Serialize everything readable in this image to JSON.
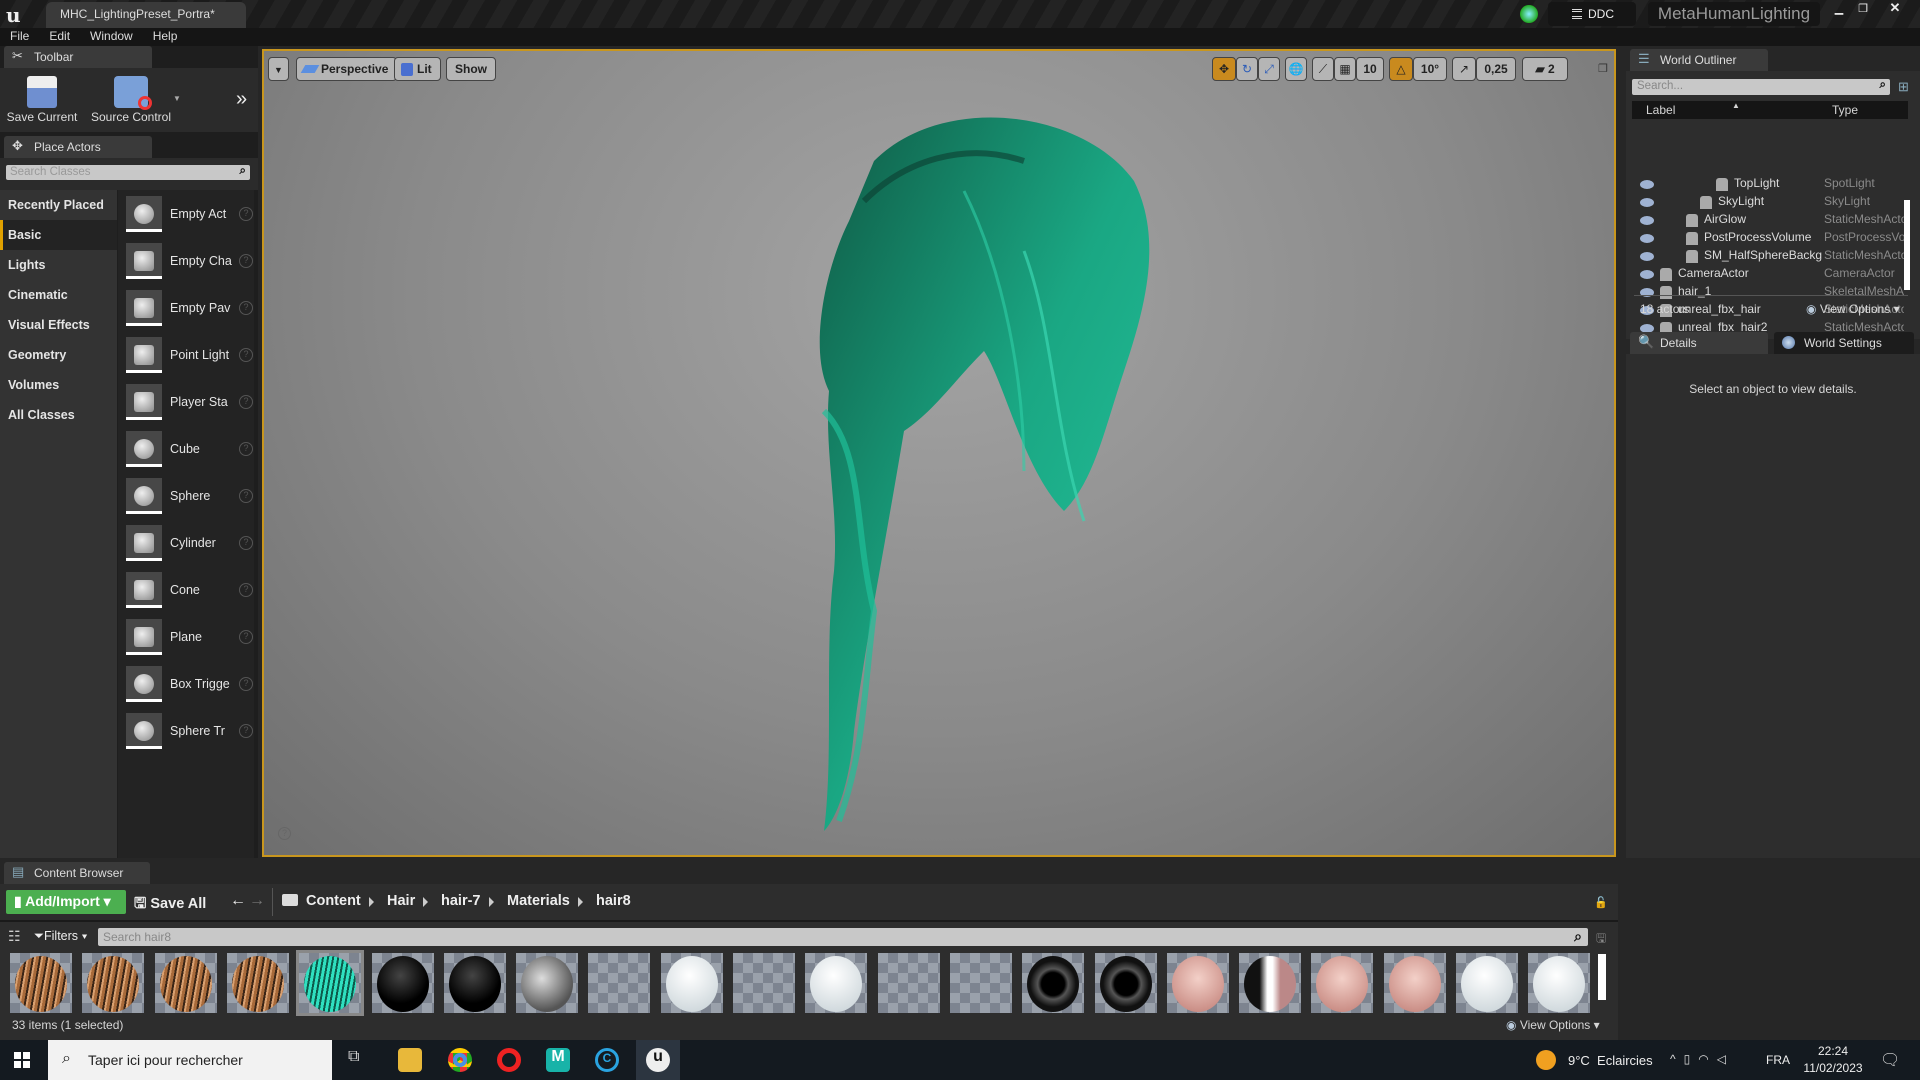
{
  "window": {
    "tab_title": "MHC_LightingPreset_Portra*",
    "ddc_label": "DDC",
    "project_name": "MetaHumanLighting"
  },
  "menu": [
    "File",
    "Edit",
    "Window",
    "Help"
  ],
  "toolbar": {
    "tab": "Toolbar",
    "save_current": "Save Current",
    "source_control": "Source Control"
  },
  "place_actors": {
    "tab": "Place Actors",
    "search_placeholder": "Search Classes",
    "categories": [
      "Recently Placed",
      "Basic",
      "Lights",
      "Cinematic",
      "Visual Effects",
      "Geometry",
      "Volumes",
      "All Classes"
    ],
    "selected_category": "Basic",
    "items": [
      "Empty Actor",
      "Empty Character",
      "Empty Pawn",
      "Point Light",
      "Player Start",
      "Cube",
      "Sphere",
      "Cylinder",
      "Cone",
      "Plane",
      "Box Trigger",
      "Sphere Trigger"
    ],
    "items_shown": [
      "Empty Act",
      "Empty Cha",
      "Empty Pav",
      "Point Light",
      "Player Sta",
      "Cube",
      "Sphere",
      "Cylinder",
      "Cone",
      "Plane",
      "Box Trigge",
      "Sphere Tr"
    ]
  },
  "viewport": {
    "view_mode": "Perspective",
    "lighting": "Lit",
    "show": "Show",
    "grid_snap": "10",
    "rotation_snap": "10°",
    "scale_snap": "0,25",
    "camera_speed": "2"
  },
  "outliner": {
    "tab": "World Outliner",
    "search_placeholder": "Search...",
    "col_label": "Label",
    "col_type": "Type",
    "rows": [
      {
        "label": "TopLight",
        "type": "SpotLight"
      },
      {
        "label": "SkyLight",
        "type": "SkyLight"
      },
      {
        "label": "AirGlow",
        "type": "StaticMeshActor"
      },
      {
        "label": "PostProcessVolume",
        "type": "PostProcessVolume"
      },
      {
        "label": "SM_HalfSphereBackg",
        "type": "StaticMeshActor"
      },
      {
        "label": "CameraActor",
        "type": "CameraActor"
      },
      {
        "label": "hair_1",
        "type": "SkeletalMeshActor"
      },
      {
        "label": "unreal_fbx_hair",
        "type": "StaticMeshActor"
      },
      {
        "label": "unreal_fbx_hair2",
        "type": "StaticMeshActor"
      }
    ],
    "count": "18 actors",
    "view_options": "View Options"
  },
  "details": {
    "tab": "Details",
    "world_settings_tab": "World Settings",
    "empty_message": "Select an object to view details."
  },
  "content_browser": {
    "tab": "Content Browser",
    "add_import": "Add/Import",
    "save_all": "Save All",
    "path": [
      "Content",
      "Hair",
      "hair-7",
      "Materials",
      "hair8"
    ],
    "filters": "Filters",
    "search_placeholder": "Search hair8",
    "status": "33 items (1 selected)",
    "view_options": "View Options",
    "thumbs": [
      "hair-brown",
      "hair-brown",
      "hair-brown",
      "hair-brown",
      "hair-teal",
      "black",
      "black",
      "grey",
      "checker",
      "white",
      "checker",
      "white",
      "checker",
      "checker",
      "dark",
      "dark",
      "skin",
      "skin-dark",
      "skin",
      "skin",
      "white",
      "white"
    ],
    "selected_index": 4
  },
  "taskbar": {
    "search_placeholder": "Taper ici pour rechercher",
    "weather": "9°C  Eclaircies",
    "language": "FRA",
    "time": "22:24",
    "date": "11/02/2023"
  },
  "colors": {
    "accent": "#c8961e",
    "add_import": "#4caf50",
    "hair": "#1db58c"
  }
}
